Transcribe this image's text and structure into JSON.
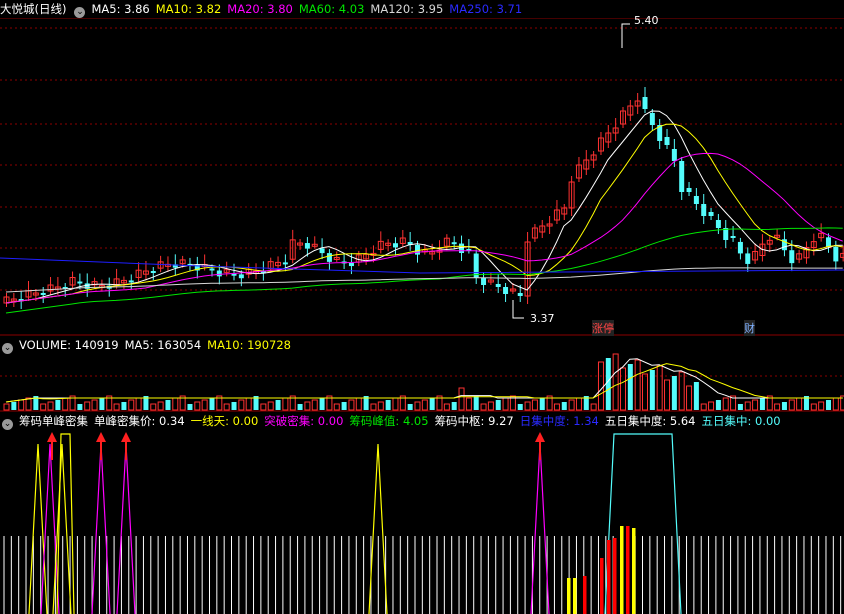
{
  "price_header": {
    "title": "大悦城(日线)",
    "ma5": "MA5: 3.86",
    "ma10": "MA10: 3.82",
    "ma20": "MA20: 3.80",
    "ma60": "MA60: 4.03",
    "ma120": "MA120: 3.95",
    "ma250": "MA250: 3.71"
  },
  "price_labels": {
    "high": "5.40",
    "low": "3.37"
  },
  "event_tags": {
    "tag1": "涨停",
    "tag2": "财"
  },
  "volume_header": {
    "volume": "VOLUME: 140919",
    "ma5": "MA5: 163054",
    "ma10": "MA10: 190728"
  },
  "chip_header": {
    "name": "筹码单峰密集",
    "single_peak_price": "单峰密集价: 0.34",
    "one_line": "一线天: 0.00",
    "breakout": "突破密集: 0.00",
    "peak_value": "筹码峰值: 4.05",
    "center": "筹码中枢: 9.27",
    "day_conc": "日集中度: 1.34",
    "five_day_conc": "五日集中度: 5.64",
    "five_day_conc2": "五日集中: 0.00"
  },
  "colors": {
    "up": "#ff3232",
    "down": "#54fcfc",
    "ma5": "#ffffff",
    "ma10": "#ffff00",
    "ma20": "#ff00ff",
    "ma60": "#00e600",
    "ma120": "#d8d8d8",
    "ma250": "#1e1eff"
  },
  "icons": [
    "collapse-circle-icon",
    "peak-arrow-icon"
  ]
}
